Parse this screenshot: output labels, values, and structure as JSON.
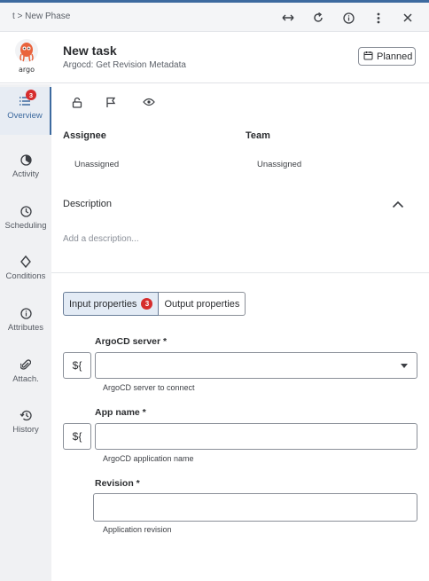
{
  "breadcrumb": "t > New Phase",
  "task": {
    "title": "New task",
    "subtitle": "Argocd: Get Revision Metadata",
    "status": "Planned"
  },
  "sidebar": {
    "items": [
      {
        "label": "Overview",
        "icon": "list-icon",
        "badge": "3",
        "active": true
      },
      {
        "label": "Activity",
        "icon": "pie-icon"
      },
      {
        "label": "Scheduling",
        "icon": "clock-icon"
      },
      {
        "label": "Conditions",
        "icon": "diamond-icon"
      },
      {
        "label": "Attributes",
        "icon": "info-icon"
      },
      {
        "label": "Attach.",
        "icon": "paperclip-icon"
      },
      {
        "label": "History",
        "icon": "history-icon"
      }
    ]
  },
  "overview": {
    "assignee_label": "Assignee",
    "assignee_value": "Unassigned",
    "team_label": "Team",
    "team_value": "Unassigned",
    "description_label": "Description",
    "description_placeholder": "Add a description..."
  },
  "properties": {
    "tabs": [
      {
        "label": "Input properties",
        "count": "3",
        "active": true
      },
      {
        "label": "Output properties"
      }
    ],
    "fields": [
      {
        "label": "ArgoCD server *",
        "helper": "ArgoCD server to connect",
        "value": "",
        "type": "select",
        "variable_button": "${"
      },
      {
        "label": "App name *",
        "helper": "ArgoCD application name",
        "value": "",
        "type": "text",
        "variable_button": "${"
      },
      {
        "label": "Revision *",
        "helper": "Application revision",
        "value": "",
        "type": "text"
      }
    ]
  },
  "colors": {
    "accent": "#3d6a9f",
    "badge": "#d62d2d",
    "sidebar_bg": "#f0f1f3"
  }
}
